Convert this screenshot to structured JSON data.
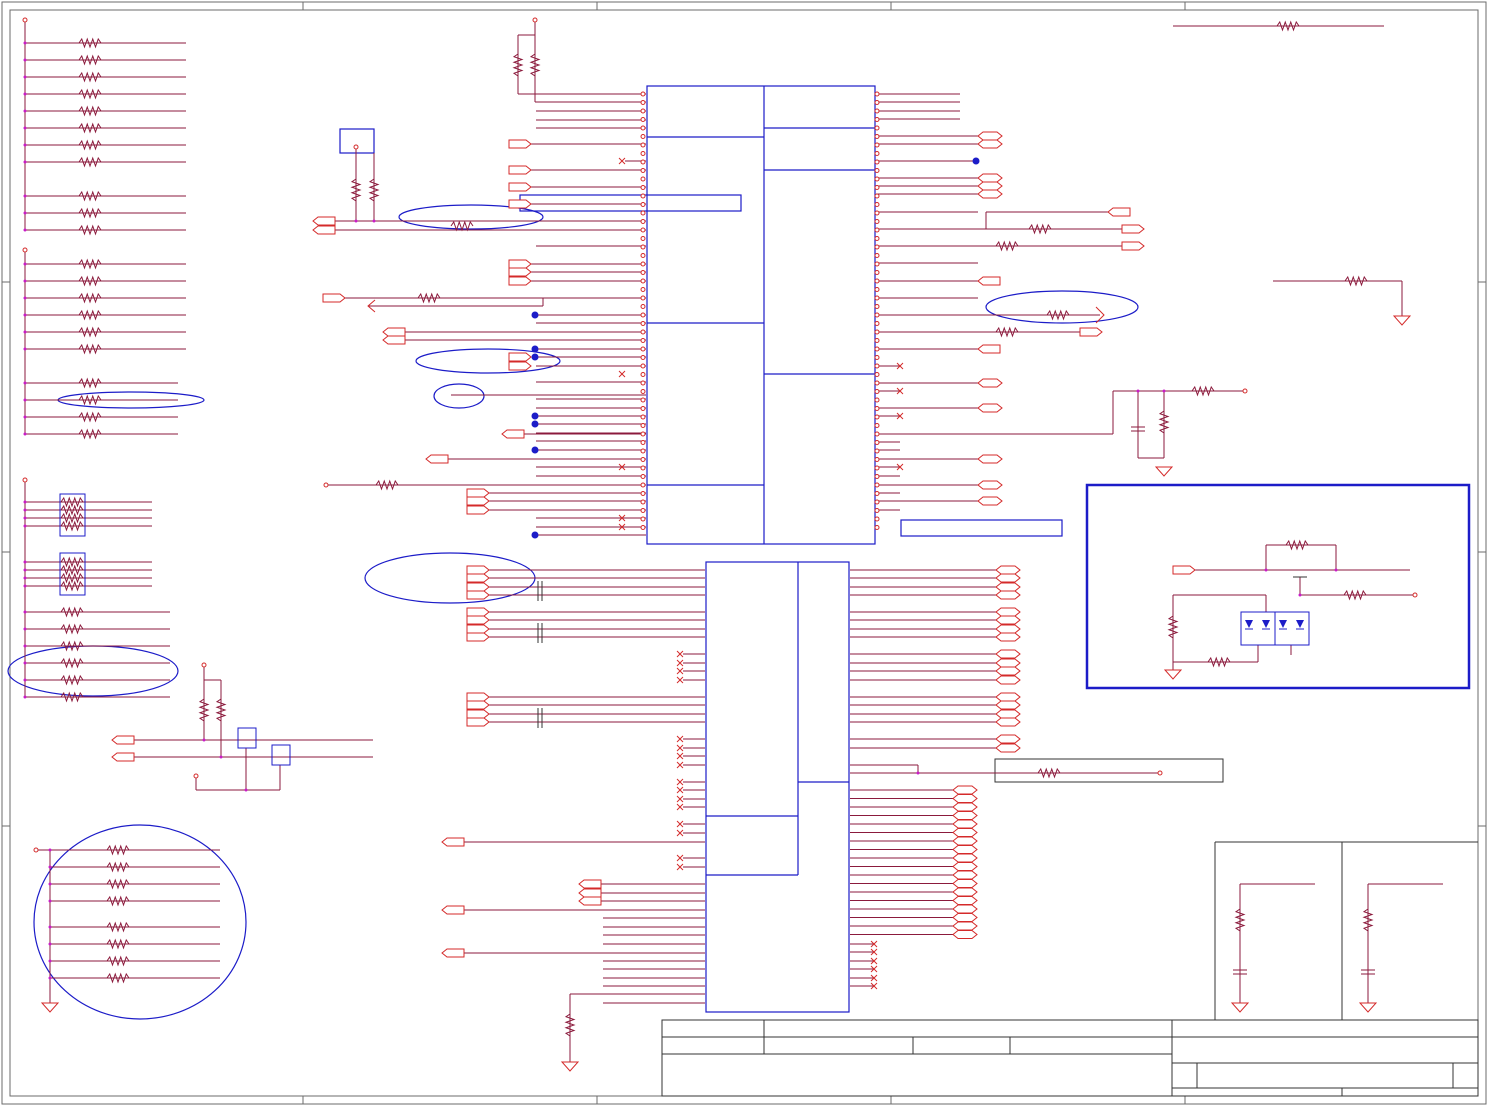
{
  "drawing": {
    "type": "electrical-schematic",
    "text_labels": [],
    "colors": {
      "wire": "#8b1a3c",
      "net_port": "#d42a2a",
      "ic_outline": "#1c1cc8",
      "junction": "#c81cc8",
      "frame": "#6b6b6b"
    },
    "icons": [
      "resistor-icon",
      "capacitor-icon",
      "diode-icon",
      "ground-icon",
      "net-port-icon",
      "no-connect-icon",
      "transistor-icon"
    ]
  }
}
